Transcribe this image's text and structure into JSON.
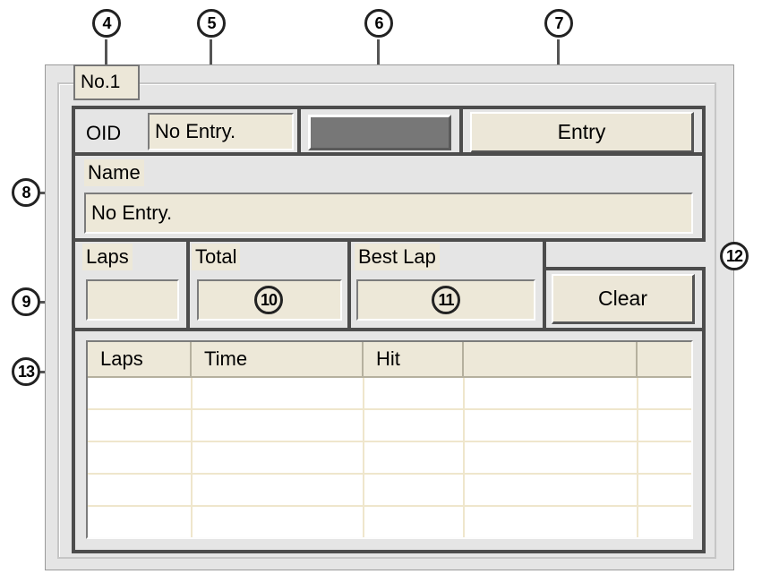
{
  "callouts": {
    "c4": "4",
    "c5": "5",
    "c6": "6",
    "c7": "7",
    "c8": "8",
    "c9": "9",
    "c10": "10",
    "c11": "11",
    "c12": "12",
    "c13": "13"
  },
  "panel": {
    "title": "No.1",
    "oid_label": "OID",
    "oid_value": "No Entry.",
    "entry_button": "Entry",
    "name_label": "Name",
    "name_value": "No Entry.",
    "laps_label": "Laps",
    "total_label": "Total",
    "best_lap_label": "Best Lap",
    "clear_button": "Clear"
  },
  "table": {
    "columns": [
      "Laps",
      "Time",
      "Hit",
      "",
      ""
    ],
    "rows": [
      [
        "",
        "",
        "",
        "",
        ""
      ],
      [
        "",
        "",
        "",
        "",
        ""
      ],
      [
        "",
        "",
        "",
        "",
        ""
      ],
      [
        "",
        "",
        "",
        "",
        ""
      ],
      [
        "",
        "",
        "",
        "",
        ""
      ]
    ]
  },
  "colors": {
    "status_indicator": "#777777",
    "field_bg": "#ede8d8",
    "frame": "#4c4c4c"
  }
}
